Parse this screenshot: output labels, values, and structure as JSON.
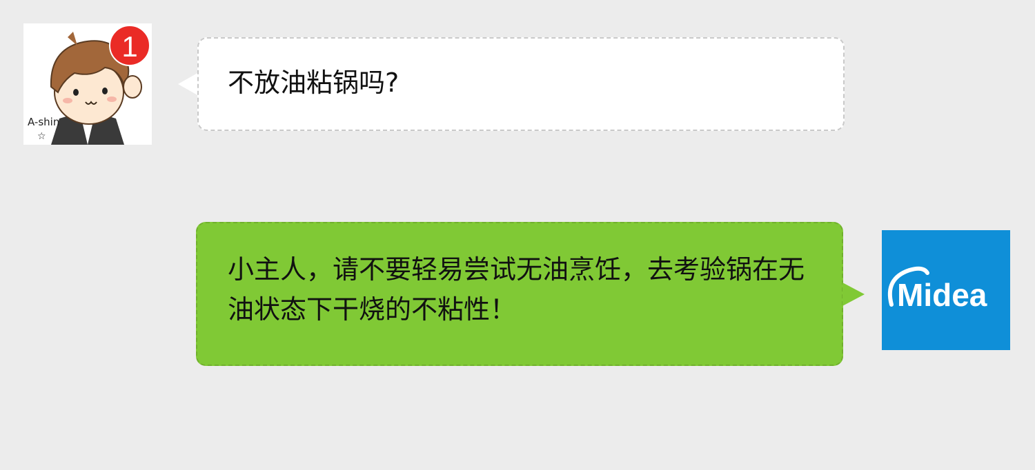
{
  "chat": {
    "messages": [
      {
        "sender": "incoming",
        "text": "不放油粘锅吗?",
        "unread_badge": "1"
      },
      {
        "sender": "outgoing",
        "text": "小主人，请不要轻易尝试无油烹饪，去考验锅在无油状态下干烧的不粘性！"
      }
    ],
    "right_avatar_logo_text": "Midea"
  },
  "colors": {
    "background": "#ececec",
    "incoming_bubble": "#ffffff",
    "outgoing_bubble": "#80c935",
    "badge": "#ea2b26",
    "logo_bg": "#0f8fd8"
  },
  "icons": {
    "left_avatar": "cartoon-boy-avatar",
    "right_avatar": "midea-logo"
  }
}
